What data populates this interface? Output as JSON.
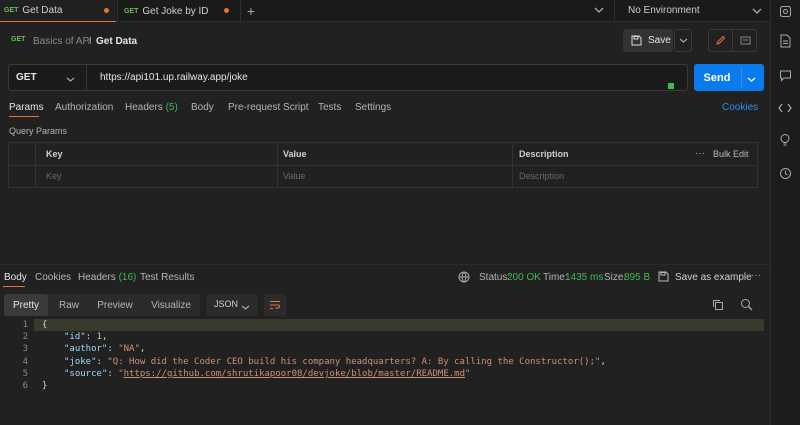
{
  "tabs": [
    {
      "method": "GET",
      "label": "Get Data"
    },
    {
      "method": "GET",
      "label": "Get Joke by ID"
    }
  ],
  "environment": "No Environment",
  "breadcrumb": {
    "collection": "Basics of API",
    "separator": "/",
    "request": "Get Data"
  },
  "header": {
    "save_label": "Save"
  },
  "request": {
    "method": "GET",
    "url": "https://api101.up.railway.app/joke",
    "send_label": "Send"
  },
  "request_tabs": {
    "params": "Params",
    "authorization": "Authorization",
    "headers": "Headers",
    "headers_count": "(5)",
    "body": "Body",
    "prerequest": "Pre-request Script",
    "tests": "Tests",
    "settings": "Settings",
    "cookies": "Cookies"
  },
  "query_params": {
    "title": "Query Params",
    "columns": [
      "Key",
      "Value",
      "Description"
    ],
    "bulk_edit": "Bulk Edit",
    "placeholders": {
      "key": "Key",
      "value": "Value",
      "description": "Description"
    }
  },
  "response": {
    "tabs": {
      "body": "Body",
      "cookies": "Cookies",
      "headers": "Headers",
      "headers_count": "(16)",
      "tests": "Test Results"
    },
    "status_label": "Status:",
    "status_value": "200 OK",
    "time_label": "Time:",
    "time_value": "1435 ms",
    "size_label": "Size:",
    "size_value": "895 B",
    "save_example": "Save as example",
    "views": [
      "Pretty",
      "Raw",
      "Preview",
      "Visualize"
    ],
    "format": "JSON",
    "json": {
      "id": "1",
      "author": "\"NA\"",
      "joke": "\"Q: How did the Coder CEO build his company headquarters? A: By calling the Constructor();\"",
      "source": "https://github.com/shrutikapoor08/devjoke/blob/master/README.md"
    },
    "line_numbers": [
      "1",
      "2",
      "3",
      "4",
      "5",
      "6"
    ]
  },
  "colors": {
    "accent": "#e8713c",
    "send": "#097bed",
    "get": "#6bbf59",
    "status_ok": "#3fb950",
    "link": "#2f8cf0"
  }
}
